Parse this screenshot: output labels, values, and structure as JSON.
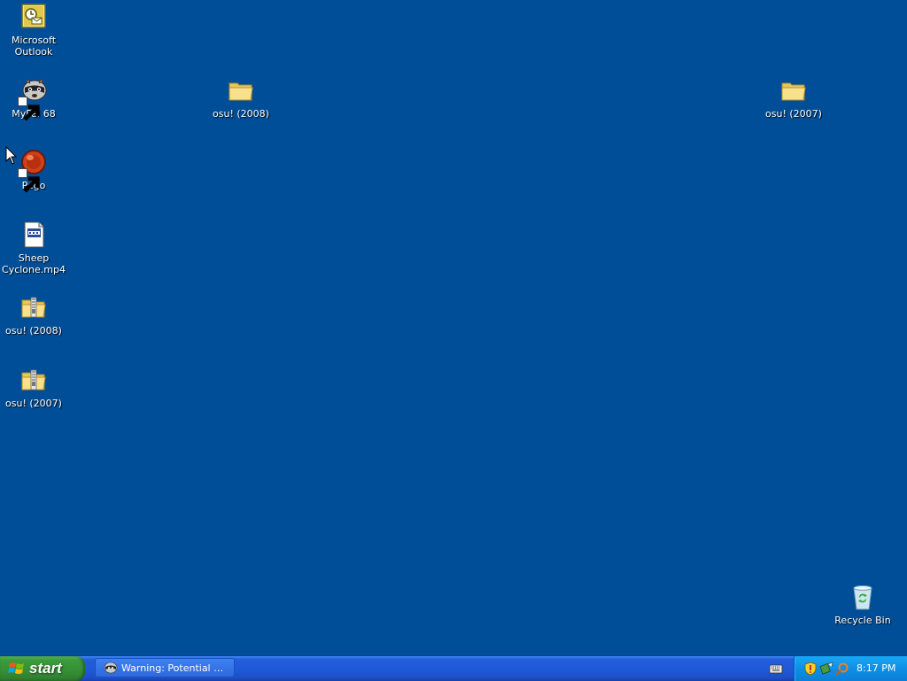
{
  "desktop": {
    "background_color": "#004e98",
    "icons": [
      {
        "id": "outlook",
        "label": "Microsoft Outlook",
        "icon": "outlook-icon",
        "shortcut": false
      },
      {
        "id": "mypal",
        "label": "MyPal 68",
        "icon": "mypal-raccoon-icon",
        "shortcut": true
      },
      {
        "id": "osu2008folder",
        "label": "osu! (2008)",
        "icon": "folder-icon",
        "shortcut": false
      },
      {
        "id": "osu2007folder",
        "label": "osu! (2007)",
        "icon": "folder-icon",
        "shortcut": false
      },
      {
        "id": "pego",
        "label": "Pego",
        "icon": "pego-red-ball-icon",
        "shortcut": true
      },
      {
        "id": "sheep",
        "label": "Sheep Cyclone.mp4",
        "icon": "video-file-icon",
        "shortcut": false
      },
      {
        "id": "osu2008zip",
        "label": "osu! (2008)",
        "icon": "zip-folder-icon",
        "shortcut": false
      },
      {
        "id": "osu2007zip",
        "label": "osu! (2007)",
        "icon": "zip-folder-icon",
        "shortcut": false
      },
      {
        "id": "recycle",
        "label": "Recycle Bin",
        "icon": "recycle-bin-icon",
        "shortcut": false
      }
    ]
  },
  "taskbar": {
    "start_label": "start",
    "task_button_label": "Warning: Potential Se...",
    "clock": "8:17 PM",
    "accent_color": "#245edb",
    "tray_color": "#0f8fe6",
    "start_color": "#3c9b3c"
  }
}
